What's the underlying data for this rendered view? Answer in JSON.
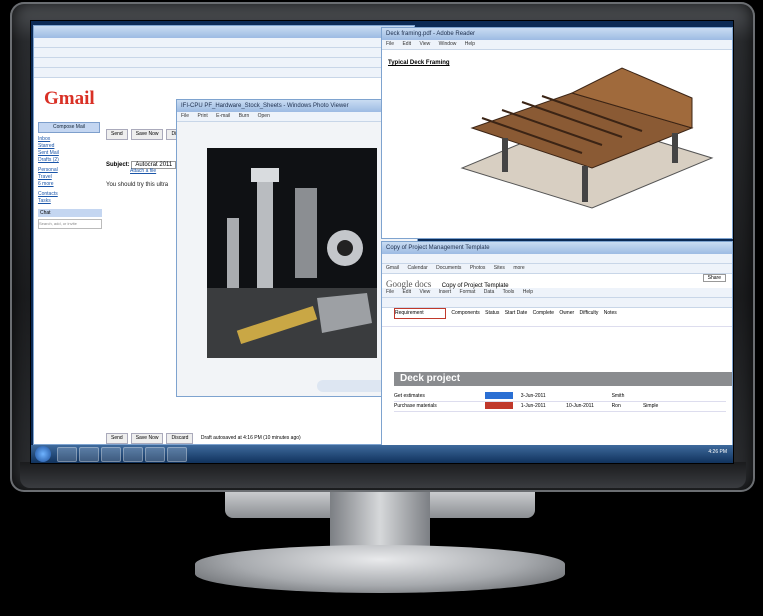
{
  "gmail": {
    "logo": "Gmail",
    "compose": "Compose Mail",
    "side_items": [
      "Inbox",
      "Starred",
      "Sent Mail",
      "Drafts (2)",
      "Personal",
      "Travel",
      "6 more"
    ],
    "side_items2": [
      "Contacts",
      "Tasks"
    ],
    "chat_header": "Chat",
    "chat_search": "Search, add, or invite",
    "send": "Send",
    "save_now": "Save Now",
    "discard": "Discard",
    "subject_label": "Subject:",
    "subject_value": "Autocrat 2011",
    "attach": "Attach a file",
    "body": "You should try this ultra",
    "autosave": "Draft autosaved at 4:16 PM (10 minutes ago)"
  },
  "viewer": {
    "title": "IFI-CPU PF_Hardware_Stock_Sheets - Windows Photo Viewer",
    "menu": [
      "File",
      "Print",
      "E-mail",
      "Burn",
      "Open"
    ]
  },
  "deck": {
    "window_title": "Deck framing.pdf - Adobe Reader",
    "menu": [
      "File",
      "Edit",
      "View",
      "Window",
      "Help"
    ],
    "title": "Typical Deck Framing"
  },
  "sheet": {
    "window_title": "Copy of Project Management Template",
    "menu": [
      "File",
      "Edit",
      "View",
      "Insert",
      "Format",
      "Data",
      "Tools",
      "Help"
    ],
    "nav": [
      "Gmail",
      "Calendar",
      "Documents",
      "Photos",
      "Sites",
      "more"
    ],
    "logo": "Google docs",
    "doc_title": "Copy of Project Template",
    "share": "Share",
    "headers": [
      "Requirement",
      "Components",
      "Status",
      "Start Date",
      "Complete",
      "Owner",
      "Difficulty",
      "Notes"
    ],
    "project_title": "Deck project",
    "rows": [
      [
        "Get estimates",
        "",
        "",
        "3-Jun-2011",
        "",
        "Smith",
        ""
      ],
      [
        "Purchase materials",
        "",
        "",
        "1-Jun-2011",
        "10-Jun-2011",
        "Ron",
        "Simple"
      ]
    ],
    "colors": {
      "header_red": "#c0392b",
      "status_blue": "#2a6fd3",
      "status_red": "#c0392b"
    }
  },
  "taskbar": {
    "clock": "4:26 PM"
  }
}
